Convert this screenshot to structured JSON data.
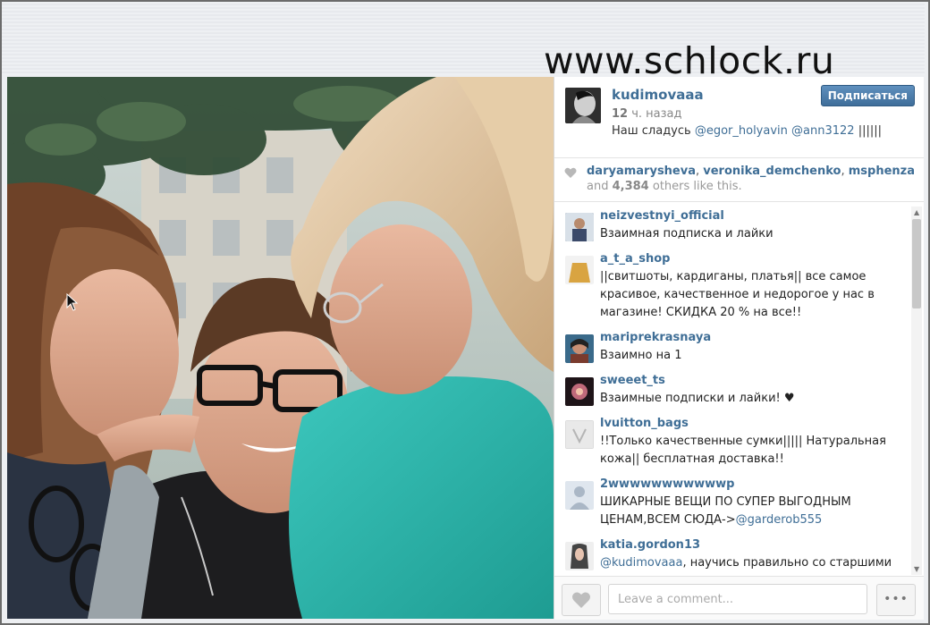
{
  "watermark": "www.schlock.ru",
  "post": {
    "username": "kudimovaaa",
    "time_number": "12",
    "time_unit": "ч. назад",
    "caption_text": "Наш сладусь ",
    "caption_mentions": [
      "@egor_holyavin",
      "@ann3122"
    ],
    "caption_tail": " ||||||",
    "follow_label": "Подписаться"
  },
  "likes": {
    "likers": [
      "daryamarysheva",
      "veronika_demchenko",
      "msphenza"
    ],
    "and": "and",
    "count": "4,384",
    "suffix": "others like this."
  },
  "comments": [
    {
      "user": "neizvestnyi_official",
      "text": "Взаимная подписка и лайки",
      "avatar_color": "#3b4a6a"
    },
    {
      "user": "a_t_a_shop",
      "text": "||свитшоты, кардиганы, платья|| все самое красивое, качественное и недорогое у нас в магазине! СКИДКА 20 % на все!!",
      "avatar_color": "#d9a441"
    },
    {
      "user": "mariprekrasnaya",
      "text": "Взаимно на 1",
      "avatar_color": "#7a3b2e"
    },
    {
      "user": "sweeet_ts",
      "text": "Взаимные подписки и лайки! ♥",
      "avatar_color": "#5a2a3a"
    },
    {
      "user": "lvuitton_bags",
      "text": "!!Только качественные сумки||||| Натуральная кожа|| бесплатная доставка!!",
      "avatar_color": "#e6e6e6"
    },
    {
      "user": "2wwwwwwwwwwwp",
      "text_before": "ШИКАРНЫЕ ВЕЩИ ПО СУПЕР ВЫГОДНЫМ ЦЕНАМ,ВСЕМ СЮДА->",
      "mention": "@garderob555",
      "avatar_color": "#dfe6ee"
    },
    {
      "user": "katia.gordon13",
      "mention": "@kudimovaaa",
      "text_after": ", научись правильно со старшими",
      "avatar_color": "#444444"
    }
  ],
  "footer": {
    "comment_placeholder": "Leave a comment...",
    "more_label": "•••"
  },
  "icons": {
    "heart": "heart-icon",
    "more": "more-options-icon",
    "cursor": "mouse-cursor-icon"
  },
  "colors": {
    "link": "#3f6e96",
    "button": "#4a7aa7",
    "turquoise_shirt": "#2bb3a8"
  }
}
